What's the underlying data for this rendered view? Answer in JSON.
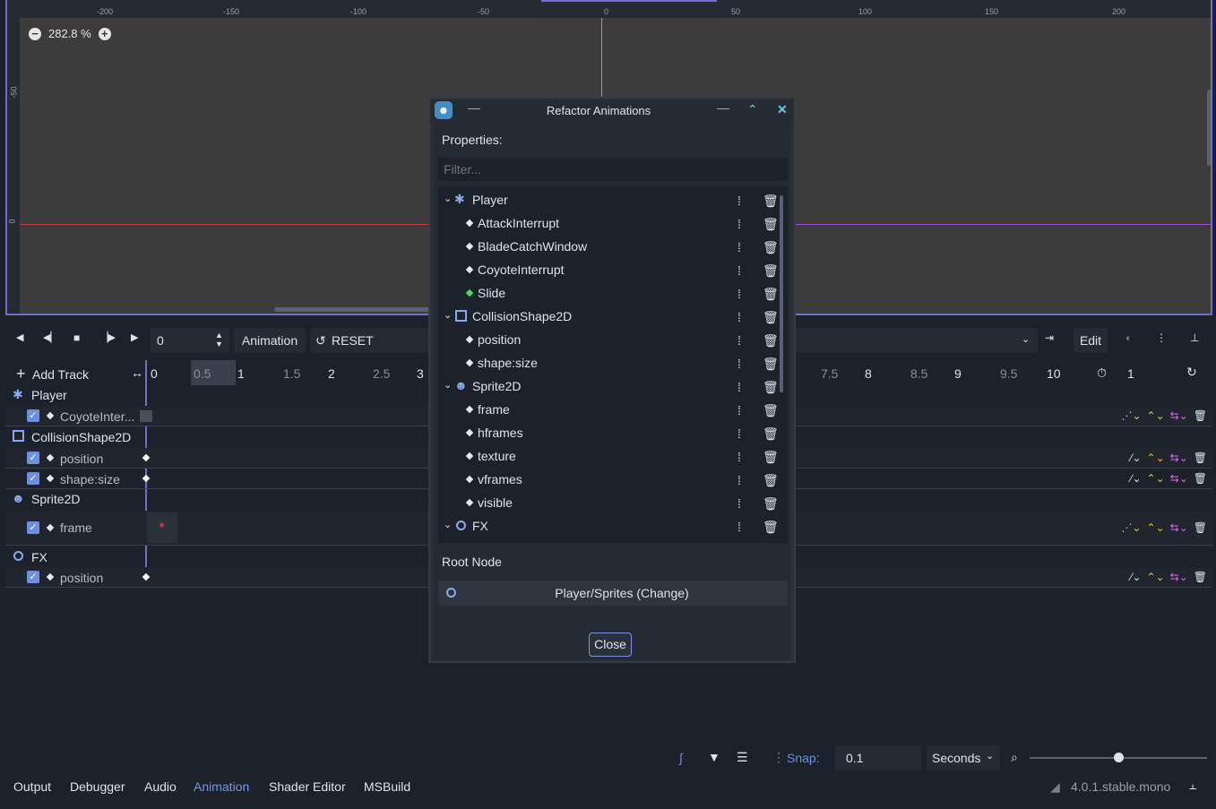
{
  "ruler": {
    "h_ticks": [
      "-200",
      "-150",
      "-100",
      "-50",
      "0",
      "50",
      "100",
      "150",
      "200"
    ],
    "v_ticks": [
      "-50",
      "0"
    ]
  },
  "viewport": {
    "zoom": "282.8 %"
  },
  "anim_toolbar": {
    "time": "0",
    "animation_label": "Animation",
    "current_anim": "RESET",
    "edit_label": "Edit"
  },
  "timeline": {
    "add_track": "Add Track",
    "ticks_left": [
      "0",
      "0.5",
      "1",
      "1.5",
      "2",
      "2.5",
      "3"
    ],
    "ticks_right": [
      "7.5",
      "8",
      "8.5",
      "9",
      "9.5",
      "10"
    ],
    "length": "1",
    "groups": [
      {
        "name": "Player",
        "icon": "skeleton-icon",
        "tracks": [
          {
            "name": "CoyoteInter..."
          }
        ]
      },
      {
        "name": "CollisionShape2D",
        "icon": "square-icon",
        "tracks": [
          {
            "name": "position"
          },
          {
            "name": "shape:size"
          }
        ]
      },
      {
        "name": "Sprite2D",
        "icon": "sprite-icon",
        "tracks": [
          {
            "name": "frame"
          }
        ]
      },
      {
        "name": "FX",
        "icon": "circle-icon",
        "tracks": [
          {
            "name": "position"
          }
        ]
      }
    ]
  },
  "bottom_toolbar": {
    "snap_label": "Snap:",
    "snap_value": "0.1",
    "unit": "Seconds"
  },
  "bottom_tabs": [
    "Output",
    "Debugger",
    "Audio",
    "Animation",
    "Shader Editor",
    "MSBuild"
  ],
  "active_tab": "Animation",
  "version": "4.0.1.stable.mono",
  "dialog": {
    "title": "Refactor Animations",
    "properties_label": "Properties:",
    "filter_placeholder": "Filter...",
    "tree": [
      {
        "label": "Player",
        "level": 0
      },
      {
        "label": "AttackInterrupt",
        "level": 1
      },
      {
        "label": "BladeCatchWindow",
        "level": 1
      },
      {
        "label": "CoyoteInterrupt",
        "level": 1
      },
      {
        "label": "Slide",
        "level": 1
      },
      {
        "label": "CollisionShape2D",
        "level": 0
      },
      {
        "label": "position",
        "level": 1
      },
      {
        "label": "shape:size",
        "level": 1
      },
      {
        "label": "Sprite2D",
        "level": 0
      },
      {
        "label": "frame",
        "level": 1
      },
      {
        "label": "hframes",
        "level": 1
      },
      {
        "label": "texture",
        "level": 1
      },
      {
        "label": "vframes",
        "level": 1
      },
      {
        "label": "visible",
        "level": 1
      },
      {
        "label": "FX",
        "level": 0
      }
    ],
    "root_node_label": "Root Node",
    "root_node_value": "Player/Sprites (Change)",
    "close_label": "Close"
  },
  "colors": {
    "accent": "#6d90e0",
    "selection": "#6f6fd1",
    "yellow": "#f5c542",
    "pink": "#d56cf0",
    "green": "#40e060"
  }
}
